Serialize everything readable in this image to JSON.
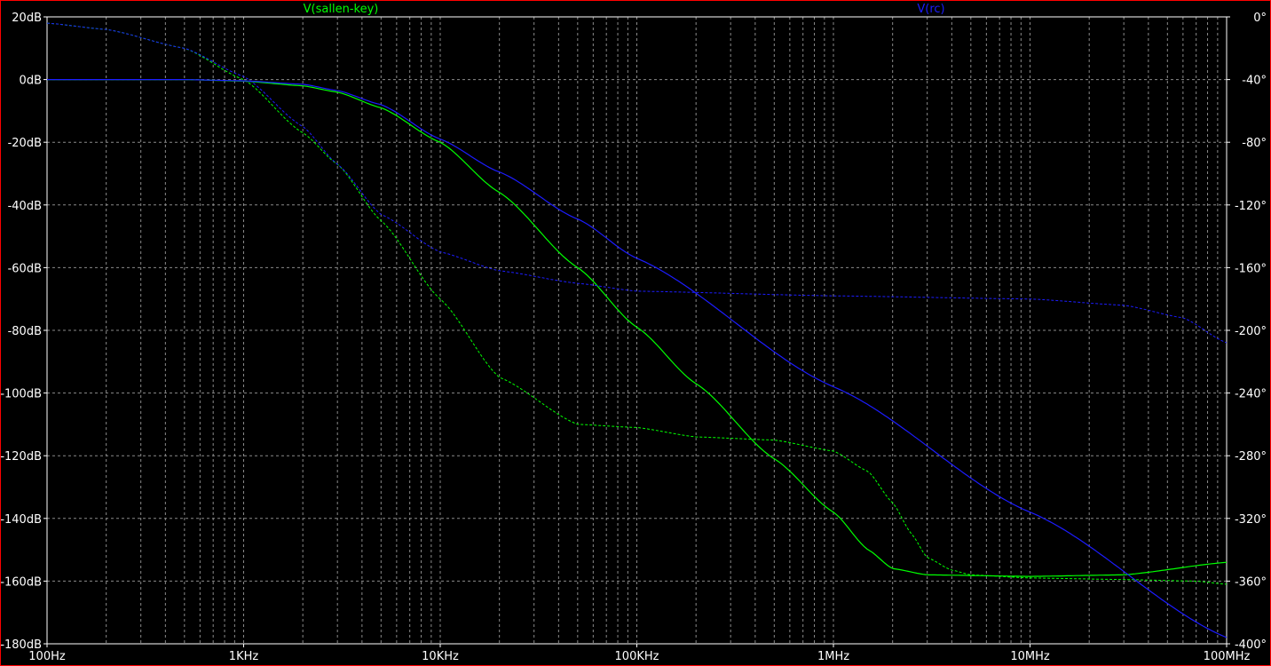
{
  "chart_data": {
    "type": "line",
    "x_scale": "log",
    "xlim_hz": [
      100,
      100000000
    ],
    "ylim_left_db": [
      -180,
      20
    ],
    "ylim_right_deg": [
      -400,
      0
    ],
    "grid": true,
    "legend_placement": "top",
    "colors": {
      "background": "#000000",
      "border": "#ff0000",
      "axis": "#ffffff",
      "grid": "#8a8a8a",
      "sallen_key": "#00ff00",
      "rc": "#1c1cff",
      "tick_label": "#ffffff"
    },
    "x_ticks": [
      {
        "value": 100,
        "label": "100Hz"
      },
      {
        "value": 1000,
        "label": "1KHz"
      },
      {
        "value": 10000,
        "label": "10KHz"
      },
      {
        "value": 100000,
        "label": "100KHz"
      },
      {
        "value": 1000000,
        "label": "1MHz"
      },
      {
        "value": 10000000,
        "label": "10MHz"
      },
      {
        "value": 100000000,
        "label": "100MHz"
      }
    ],
    "y_left_ticks": [
      {
        "value": 20,
        "label": "20dB"
      },
      {
        "value": 0,
        "label": "0dB"
      },
      {
        "value": -20,
        "label": "-20dB"
      },
      {
        "value": -40,
        "label": "-40dB"
      },
      {
        "value": -60,
        "label": "-60dB"
      },
      {
        "value": -80,
        "label": "-80dB"
      },
      {
        "value": -100,
        "label": "-100dB"
      },
      {
        "value": -120,
        "label": "-120dB"
      },
      {
        "value": -140,
        "label": "-140dB"
      },
      {
        "value": -160,
        "label": "-160dB"
      },
      {
        "value": -180,
        "label": "-180dB"
      }
    ],
    "y_right_ticks": [
      {
        "value": 0,
        "label": "0°"
      },
      {
        "value": -40,
        "label": "-40°"
      },
      {
        "value": -80,
        "label": "-80°"
      },
      {
        "value": -120,
        "label": "-120°"
      },
      {
        "value": -160,
        "label": "-160°"
      },
      {
        "value": -200,
        "label": "-200°"
      },
      {
        "value": -240,
        "label": "-240°"
      },
      {
        "value": -280,
        "label": "-280°"
      },
      {
        "value": -320,
        "label": "-320°"
      },
      {
        "value": -360,
        "label": "-360°"
      },
      {
        "value": -400,
        "label": "-400°"
      }
    ],
    "series": [
      {
        "name": "V(sallen-key)",
        "color": "#00ff00",
        "magnitude_db": {
          "x": [
            100,
            500,
            1000,
            2000,
            3000,
            5000,
            10000,
            20000,
            50000,
            100000,
            200000,
            500000,
            1000000,
            1500000,
            2000000,
            3000000,
            10000000,
            30000000,
            100000000
          ],
          "y": [
            0,
            0,
            -0.5,
            -2,
            -4,
            -9,
            -20,
            -36,
            -60,
            -79,
            -97,
            -121,
            -138,
            -150,
            -156,
            -158,
            -158.5,
            -158,
            -154
          ]
        },
        "phase_deg": {
          "x": [
            100,
            200,
            500,
            1000,
            2000,
            3000,
            5000,
            10000,
            20000,
            50000,
            100000,
            200000,
            500000,
            1000000,
            1500000,
            2000000,
            2500000,
            3000000,
            4000000,
            5000000,
            10000000,
            30000000,
            70000000,
            100000000
          ],
          "y": [
            -4,
            -8,
            -20,
            -40,
            -74,
            -94,
            -130,
            -180,
            -230,
            -260,
            -262,
            -268,
            -270,
            -277,
            -290,
            -310,
            -330,
            -345,
            -353,
            -356,
            -358,
            -359,
            -360,
            -362
          ]
        }
      },
      {
        "name": "V(rc)",
        "color": "#1c1cff",
        "magnitude_db": {
          "x": [
            100,
            500,
            1000,
            2000,
            3000,
            5000,
            10000,
            20000,
            50000,
            100000,
            1000000,
            10000000,
            100000000
          ],
          "y": [
            0,
            0,
            -0.4,
            -1.5,
            -3.5,
            -8,
            -19,
            -29.5,
            -44.5,
            -57,
            -98,
            -138,
            -178
          ]
        },
        "phase_deg": {
          "x": [
            100,
            200,
            500,
            1000,
            2000,
            3000,
            5000,
            10000,
            20000,
            50000,
            100000,
            1000000,
            10000000,
            30000000,
            60000000,
            100000000
          ],
          "y": [
            -4,
            -8,
            -20,
            -38,
            -70,
            -94,
            -126,
            -150,
            -162,
            -170,
            -175,
            -178,
            -180,
            -184,
            -192,
            -208
          ]
        }
      }
    ]
  }
}
